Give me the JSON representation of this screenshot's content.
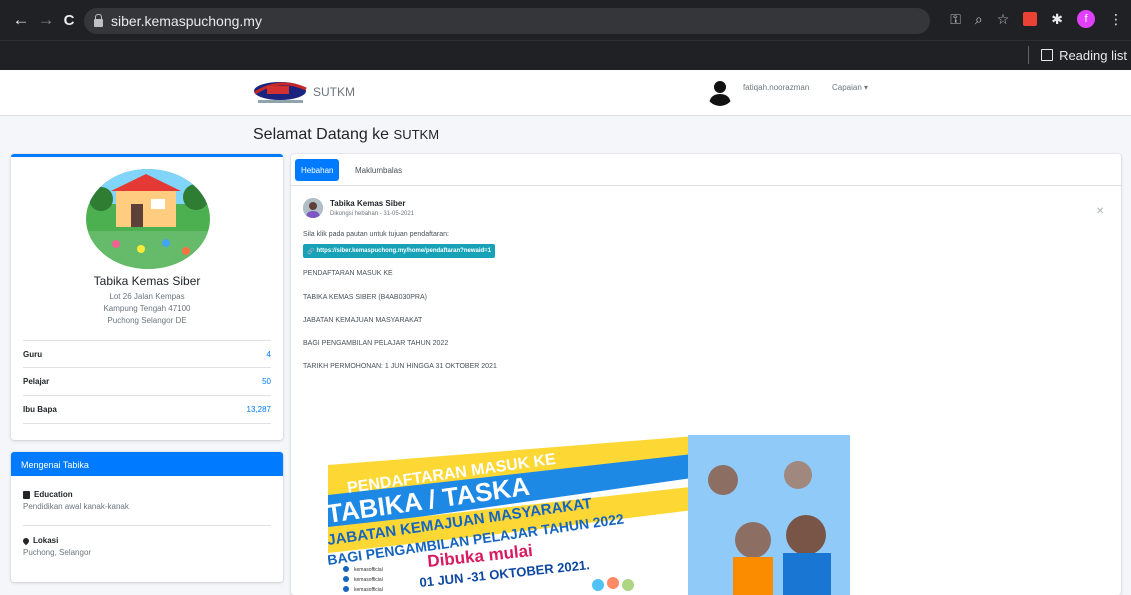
{
  "browser": {
    "url": "siber.kemaspuchong.my",
    "reading_list_label": "Reading list",
    "profile_initial": "f"
  },
  "header": {
    "brand": "SUTKM",
    "username": "fatiqah.noorazman",
    "menu_label": "Capaian"
  },
  "welcome": {
    "prefix": "Selamat Datang ke ",
    "highlight": "SUTKM"
  },
  "profile": {
    "name": "Tabika Kemas Siber",
    "address_line1": "Lot 26 Jalan Kempas",
    "address_line2": "Kampung Tengah 47100",
    "address_line3": "Puchong Selangor DE",
    "stats": [
      {
        "label": "Guru",
        "value": "4"
      },
      {
        "label": "Pelajar",
        "value": "50"
      },
      {
        "label": "Ibu Bapa",
        "value": "13,287"
      }
    ]
  },
  "about": {
    "heading": "Mengenai Tabika",
    "education_title": "Education",
    "education_text": "Pendidikan awal kanak-kanak",
    "location_title": "Lokasi",
    "location_text": "Puchong, Selangor"
  },
  "tabs": [
    {
      "label": "Hebahan",
      "active": true
    },
    {
      "label": "Maklumbalas",
      "active": false
    }
  ],
  "post": {
    "author": "Tabika Kemas Siber",
    "meta": "Dikongsi hebahan - 31-05-2021",
    "intro": "Sila klik pada pautan untuk tujuan pendaftaran:",
    "link": "https://siber.kemaspuchong.my/home/pendaftaran?newaid=1",
    "lines": [
      "PENDAFTARAN MASUK KE",
      "TABIKA KEMAS SIBER (B4AB030PRA)",
      "JABATAN KEMAJUAN MASYARAKAT",
      "BAGI PENGAMBILAN PELAJAR TAHUN 2022",
      "TARIKH PERMOHONAN: 1 JUN HINGGA 31 OKTOBER 2021"
    ]
  },
  "poster": {
    "line1": "PENDAFTARAN MASUK KE",
    "line2": "TABIKA / TASKA",
    "line3": "JABATAN KEMAJUAN MASYARAKAT",
    "line4": "BAGI PENGAMBILAN PELAJAR TAHUN 2022",
    "line5": "Dibuka mulai",
    "line6": "01 JUN -31 OKTOBER 2021.",
    "social1": "kemasofficial",
    "social2": "kemasofficial",
    "social3": "kemasofficial"
  },
  "colors": {
    "primary": "#007bff",
    "info": "#17a2b8",
    "chrome": "#202124"
  }
}
